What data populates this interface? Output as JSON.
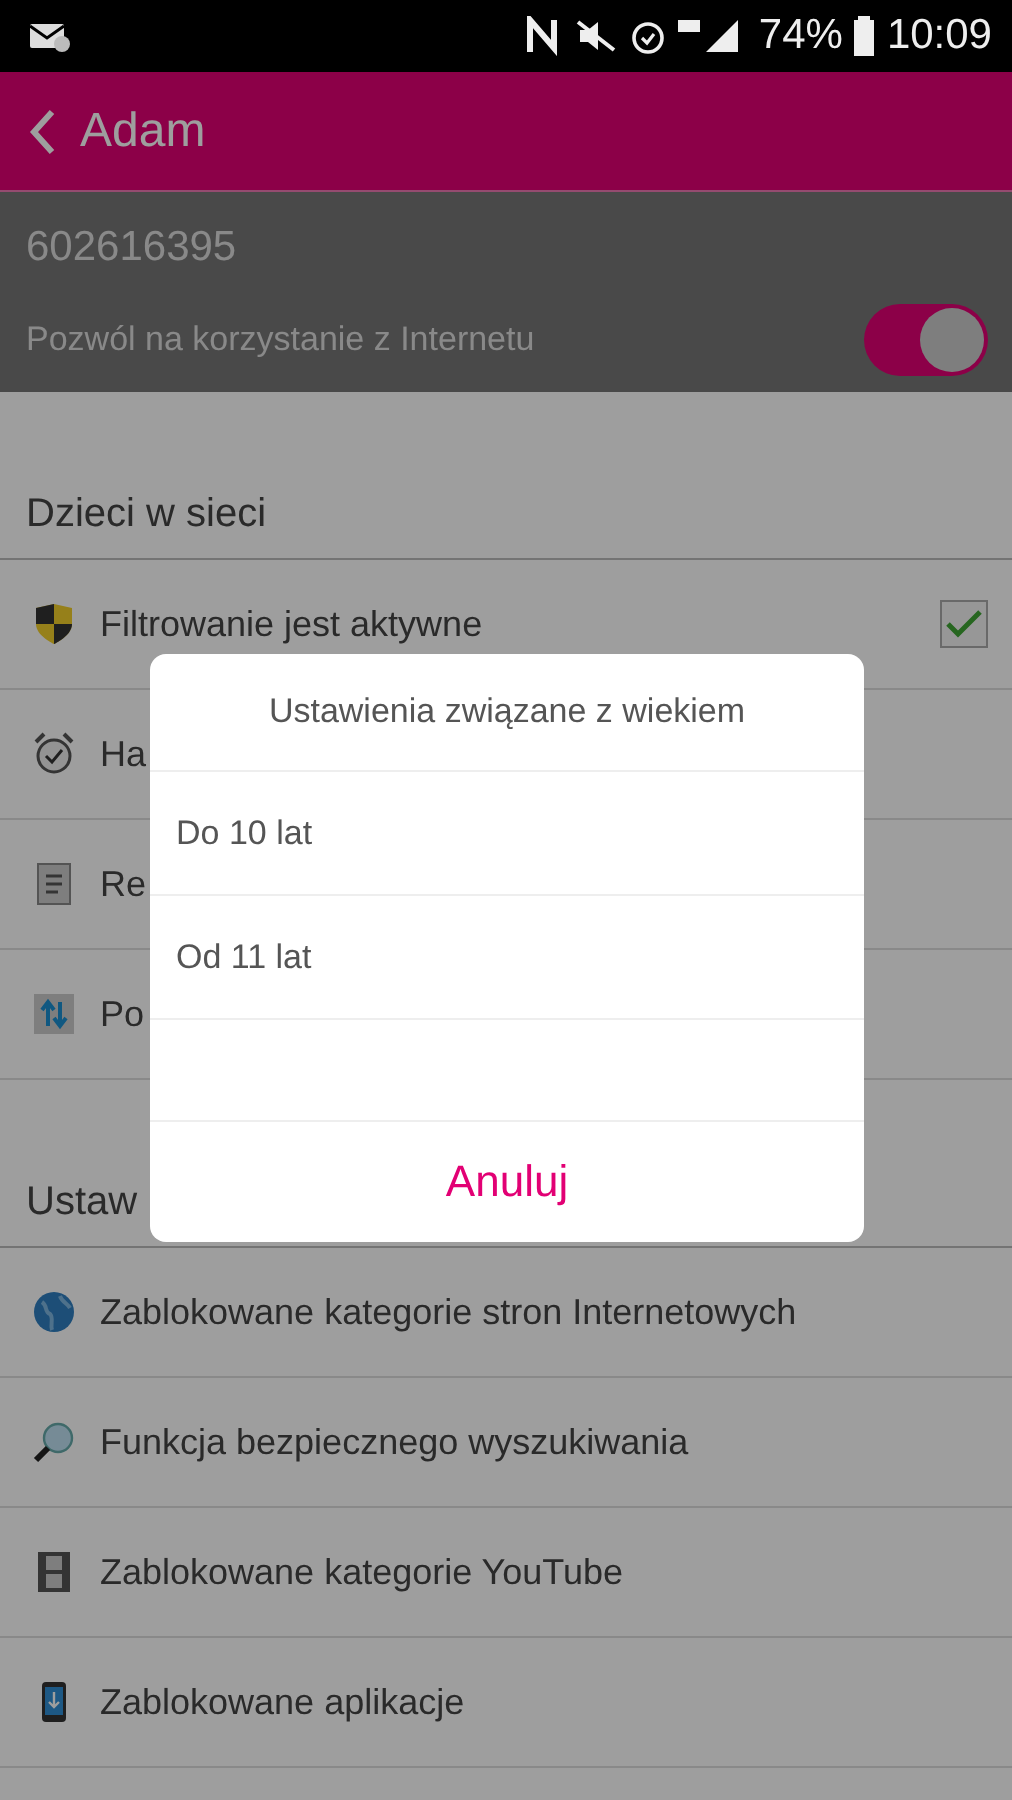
{
  "status_bar": {
    "battery": "74%",
    "time": "10:09"
  },
  "app_bar": {
    "title": "Adam"
  },
  "account": {
    "number": "602616395",
    "internet_toggle": {
      "label": "Pozwól na korzystanie z Internetu",
      "on": true
    }
  },
  "sections": [
    {
      "title": "Dzieci w sieci",
      "items": [
        {
          "kind": "checkbox",
          "label": "Filtrowanie jest aktywne",
          "checked": true
        },
        {
          "kind": "link",
          "label": "Ha"
        },
        {
          "kind": "link",
          "label": "Re"
        },
        {
          "kind": "link",
          "label": "Po"
        }
      ]
    },
    {
      "title": "Ustaw",
      "items": [
        {
          "kind": "link",
          "label": "Zablokowane kategorie stron Internetowych"
        },
        {
          "kind": "link",
          "label": "Funkcja bezpiecznego wyszukiwania"
        },
        {
          "kind": "link",
          "label": "Zablokowane kategorie YouTube"
        },
        {
          "kind": "link",
          "label": "Zablokowane aplikacje"
        }
      ]
    }
  ],
  "dialog": {
    "title": "Ustawienia związane z wiekiem",
    "options": [
      {
        "label": "Do 10 lat"
      },
      {
        "label": "Od 11 lat"
      }
    ],
    "cancel": "Anuluj"
  }
}
